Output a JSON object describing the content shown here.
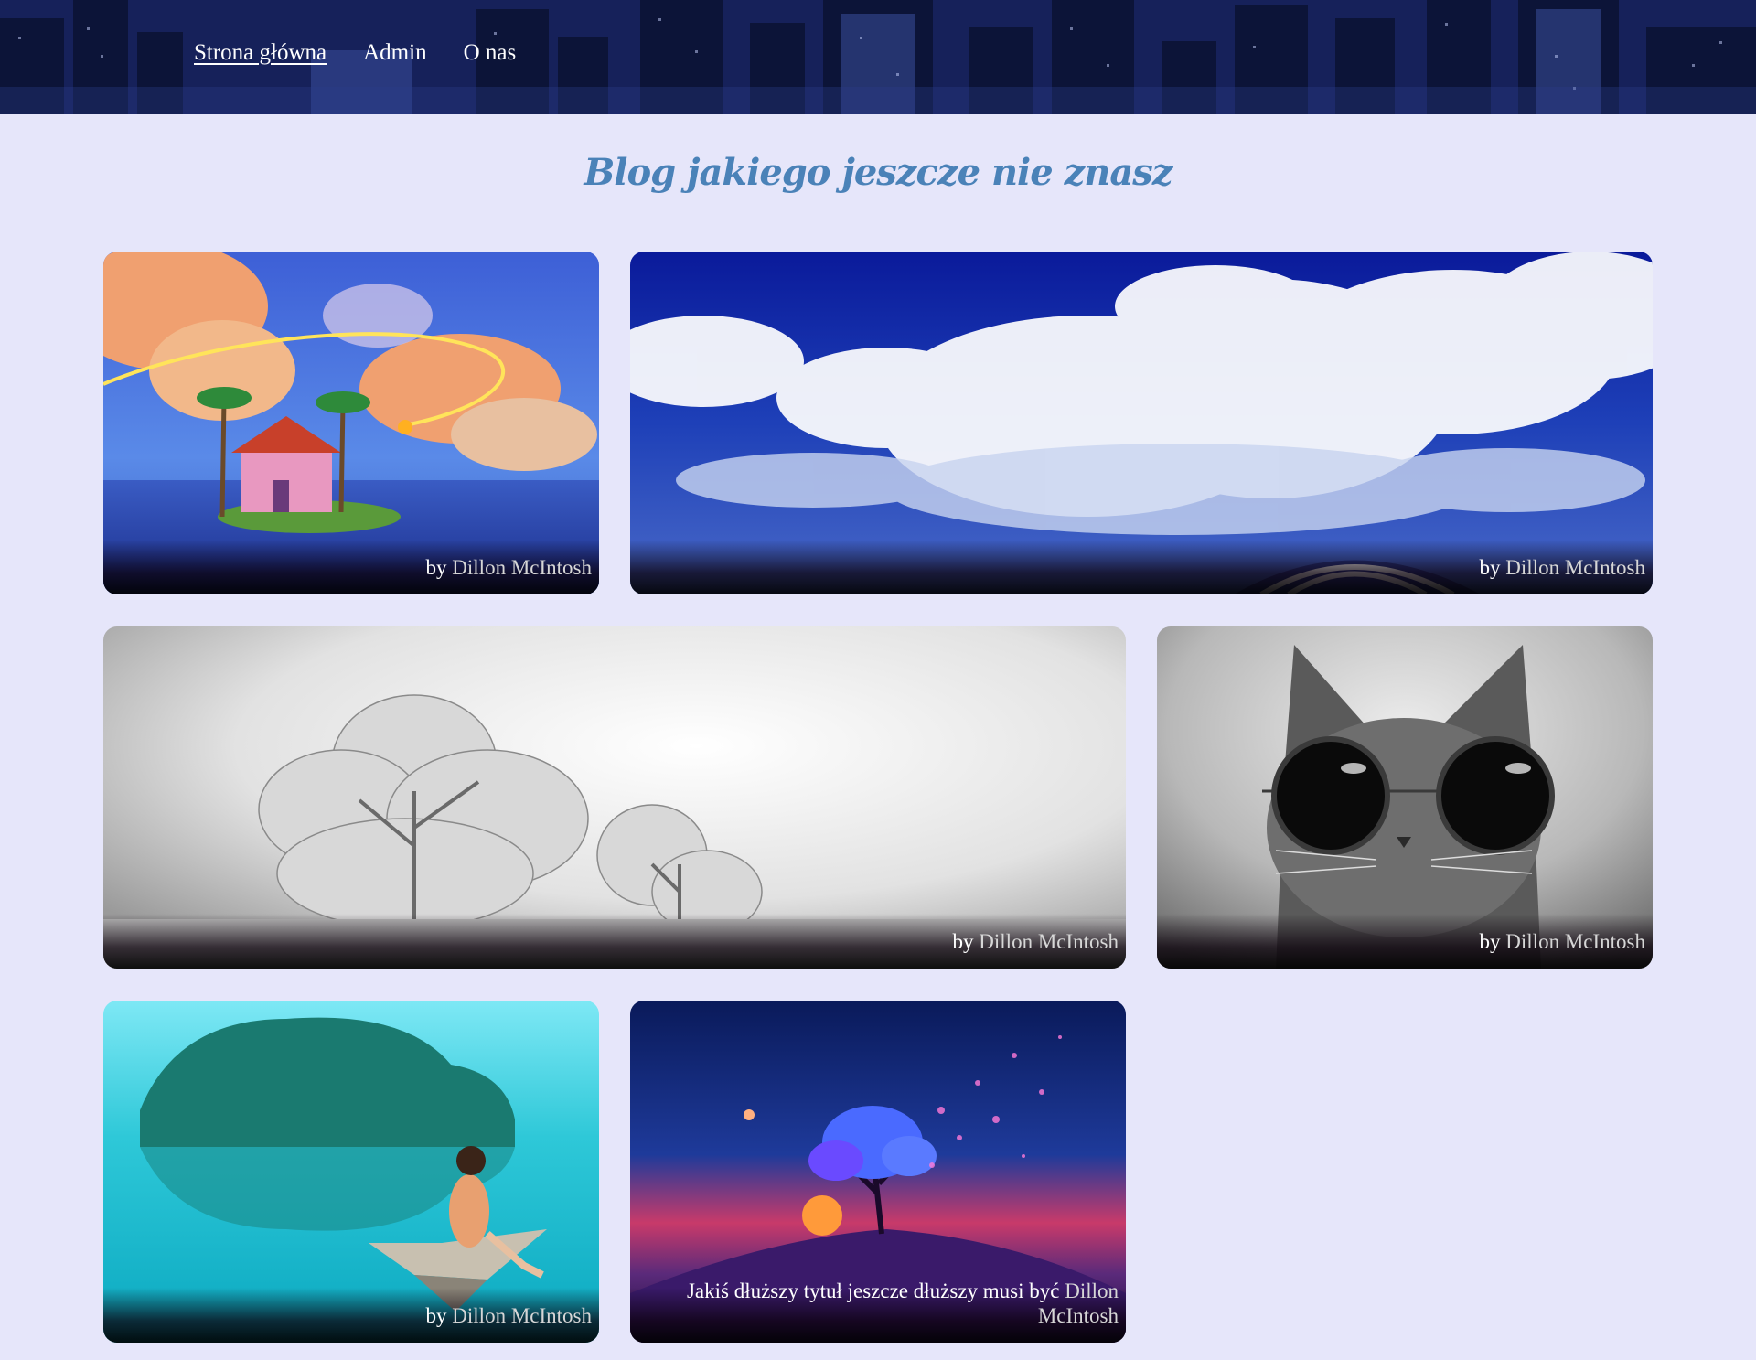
{
  "nav": {
    "items": [
      {
        "label": "Strona główna",
        "active": true
      },
      {
        "label": "Admin",
        "active": false
      },
      {
        "label": "O nas",
        "active": false
      }
    ]
  },
  "page_title": "Blog jakiego jeszcze nie znasz",
  "colors": {
    "page_background": "#e6e6fa",
    "title": "#4a82b8",
    "header": "#1a2a66"
  },
  "posts": [
    {
      "prefix": "by",
      "title": "",
      "author": "Dillon McIntosh",
      "image": "island-with-pink-house"
    },
    {
      "prefix": "by",
      "title": "",
      "author": "Dillon McIntosh",
      "image": "blue-sky-clouds"
    },
    {
      "prefix": "by",
      "title": "",
      "author": "Dillon McIntosh",
      "image": "frosted-trees"
    },
    {
      "prefix": "by",
      "title": "",
      "author": "Dillon McIntosh",
      "image": "cat-with-sunglasses"
    },
    {
      "prefix": "by",
      "title": "",
      "author": "Dillon McIntosh",
      "image": "girl-in-paper-boat"
    },
    {
      "prefix": "",
      "title": "Jakiś dłuższy tytuł jeszcze dłuższy musi być",
      "author": "Dillon McIntosh",
      "image": "blue-tree-sunset"
    }
  ]
}
